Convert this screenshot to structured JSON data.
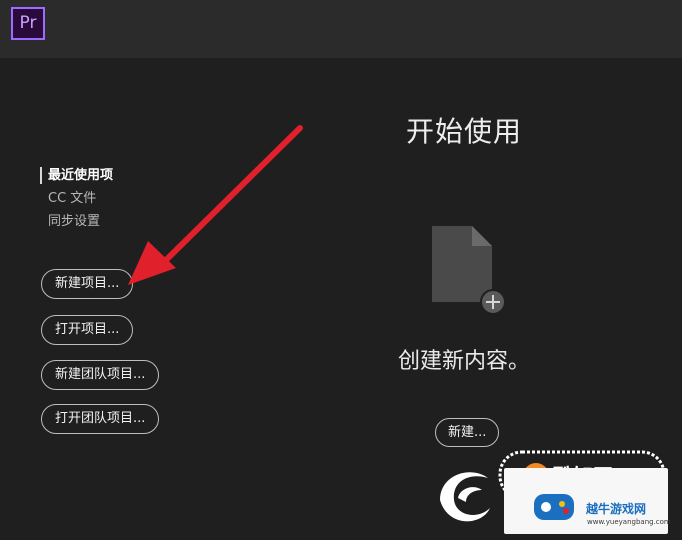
{
  "app": {
    "logo_text": "Pr",
    "brand_color": "#9b6cff"
  },
  "sidebar": {
    "items": [
      {
        "label": "最近使用项",
        "active": true
      },
      {
        "label": "CC 文件",
        "active": false
      },
      {
        "label": "同步设置",
        "active": false
      }
    ],
    "buttons": {
      "new_project": "新建项目...",
      "open_project": "打开项目...",
      "new_team_project": "新建团队项目...",
      "open_team_project": "打开团队项目..."
    }
  },
  "main": {
    "title": "开始使用",
    "empty_icon": "new-file-icon",
    "create_text": "创建新内容。",
    "new_button": "新建..."
  },
  "overlay": {
    "arrow_color": "#e0202a"
  },
  "watermarks": {
    "primary_text": "酷知网",
    "secondary_title": "越牛游戏网",
    "secondary_url": "www.yueyangbang.com"
  }
}
